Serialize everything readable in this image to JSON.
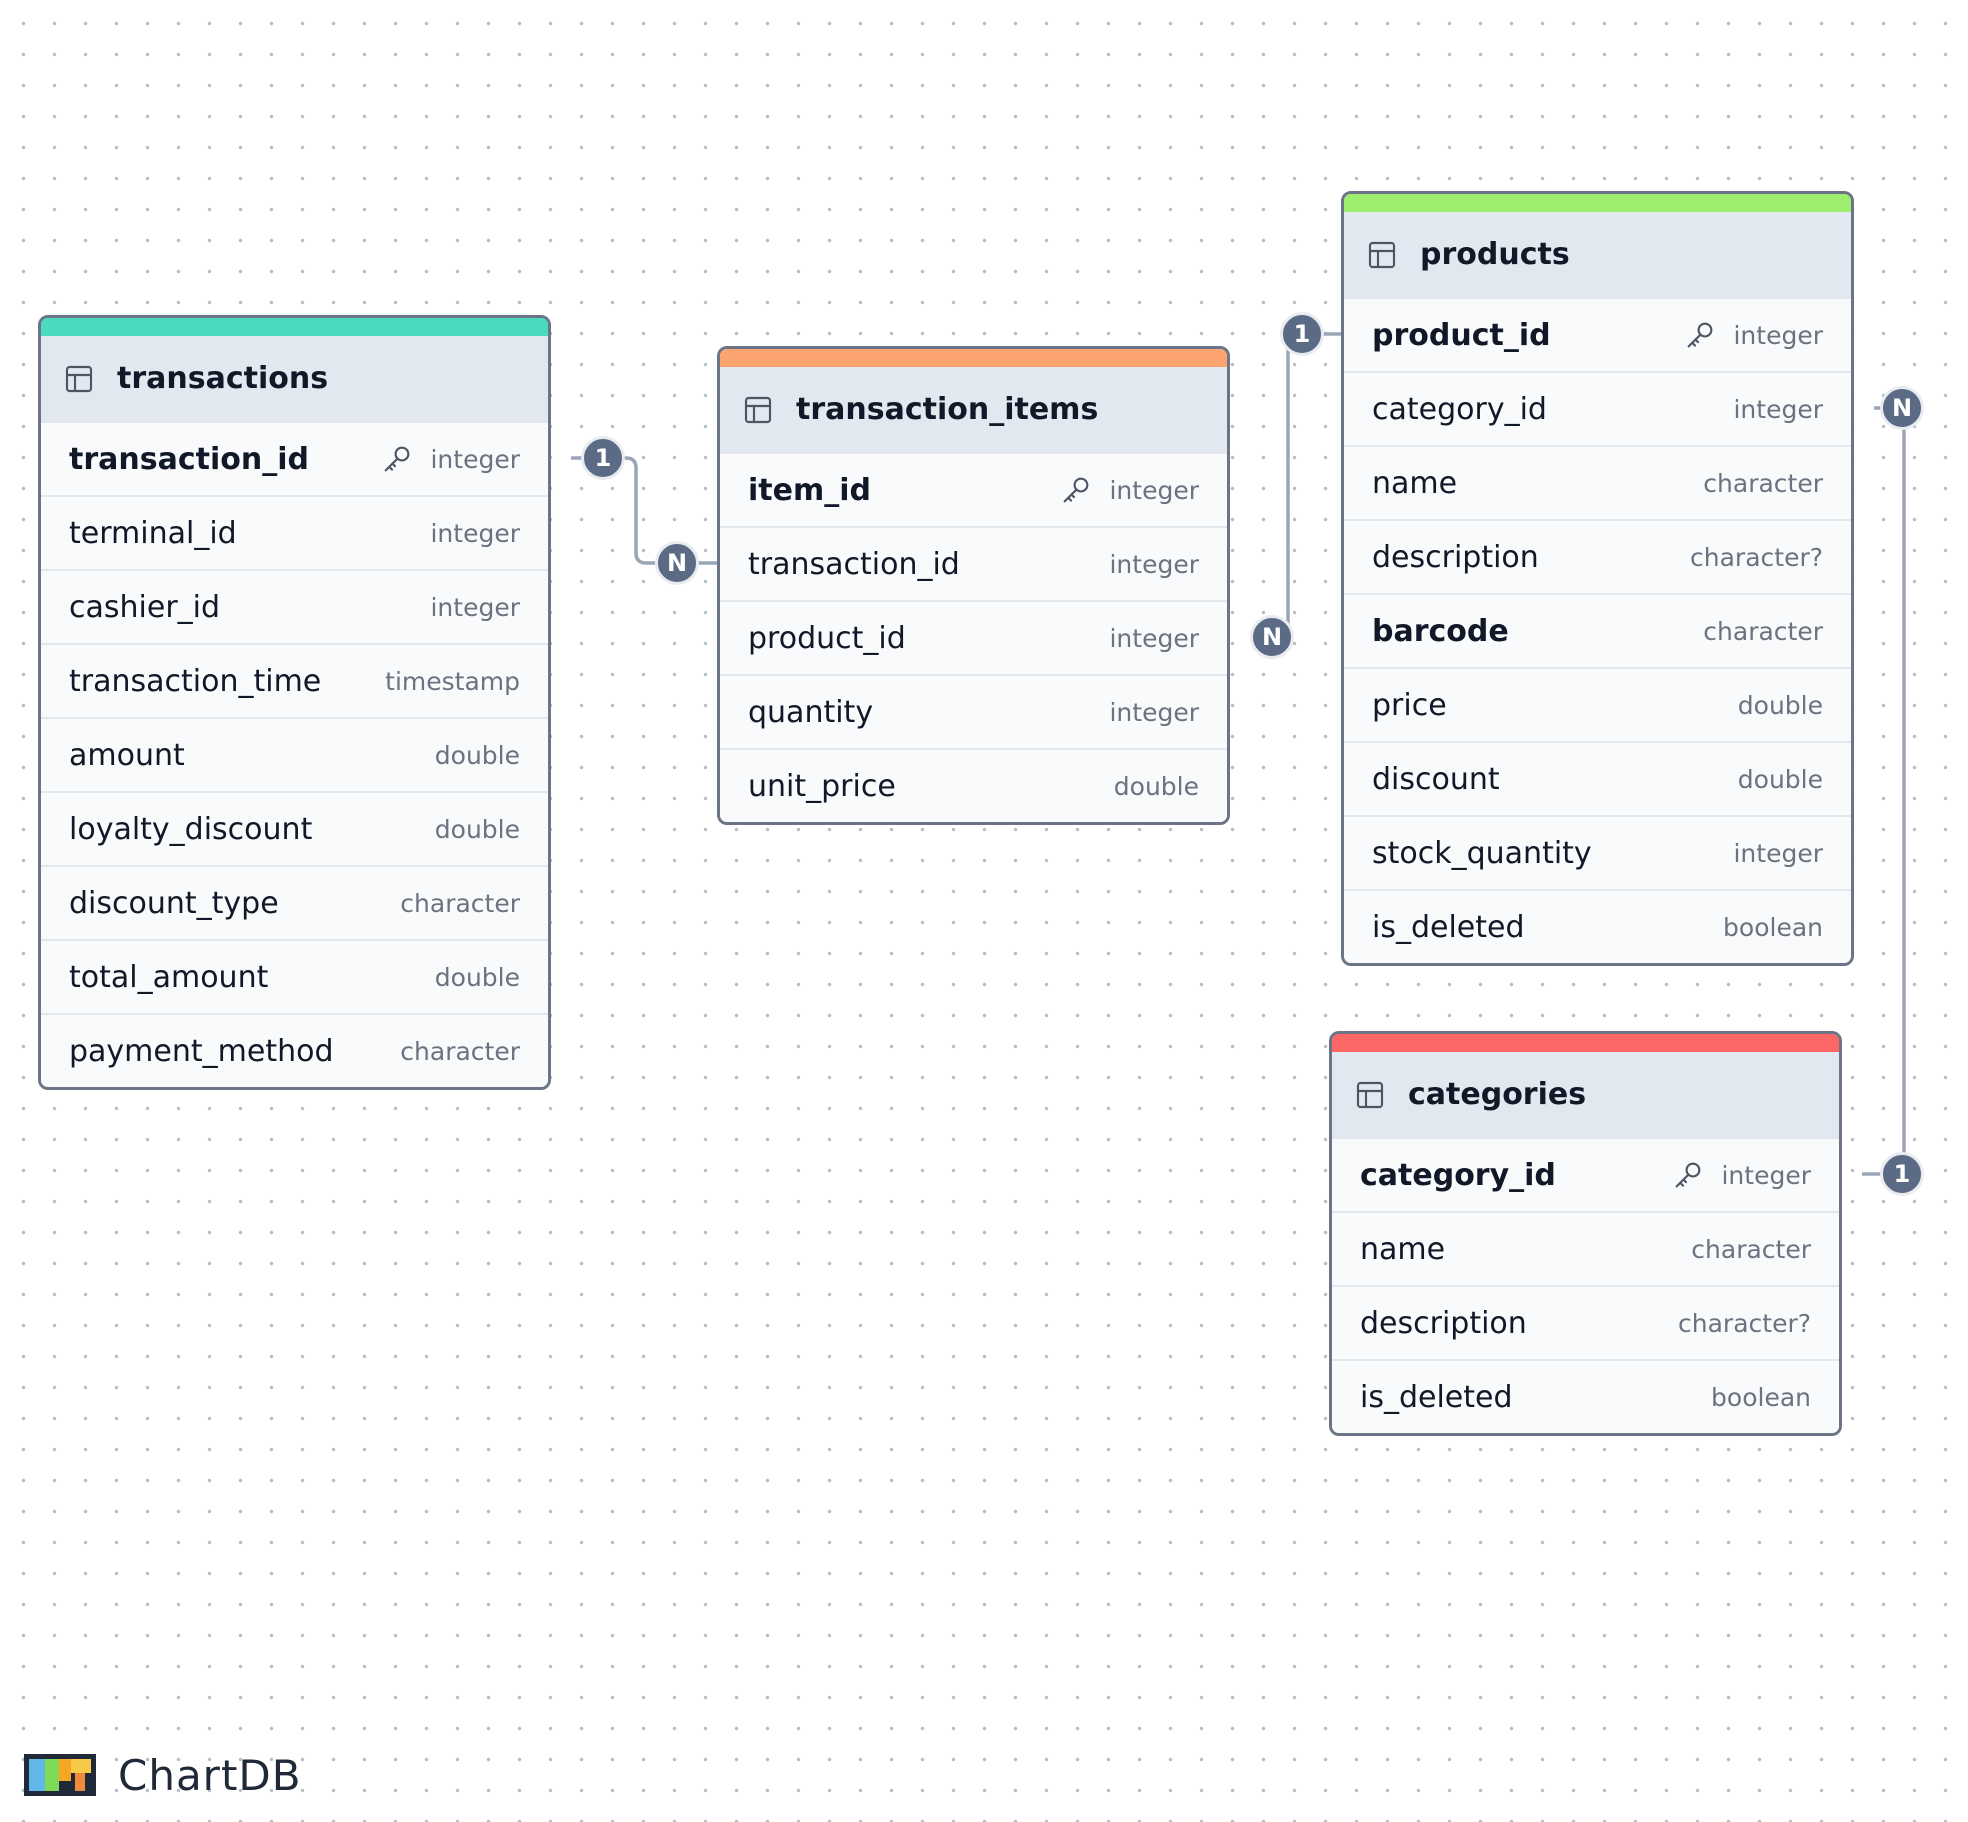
{
  "colors": {
    "transactions": "#48dbc0",
    "transaction_items": "#fca46f",
    "products": "#9ded6f",
    "categories": "#fd6666",
    "edge": "#9aa5b5",
    "badge": "#5b6b85"
  },
  "tables": [
    {
      "key": "transactions",
      "name": "transactions",
      "fields": [
        {
          "name": "transaction_id",
          "type": "integer",
          "pk": true,
          "bold": true
        },
        {
          "name": "terminal_id",
          "type": "integer"
        },
        {
          "name": "cashier_id",
          "type": "integer"
        },
        {
          "name": "transaction_time",
          "type": "timestamp"
        },
        {
          "name": "amount",
          "type": "double"
        },
        {
          "name": "loyalty_discount",
          "type": "double"
        },
        {
          "name": "discount_type",
          "type": "character"
        },
        {
          "name": "total_amount",
          "type": "double"
        },
        {
          "name": "payment_method",
          "type": "character"
        }
      ]
    },
    {
      "key": "transaction_items",
      "name": "transaction_items",
      "fields": [
        {
          "name": "item_id",
          "type": "integer",
          "pk": true,
          "bold": true
        },
        {
          "name": "transaction_id",
          "type": "integer"
        },
        {
          "name": "product_id",
          "type": "integer"
        },
        {
          "name": "quantity",
          "type": "integer"
        },
        {
          "name": "unit_price",
          "type": "double"
        }
      ]
    },
    {
      "key": "products",
      "name": "products",
      "fields": [
        {
          "name": "product_id",
          "type": "integer",
          "pk": true,
          "bold": true
        },
        {
          "name": "category_id",
          "type": "integer"
        },
        {
          "name": "name",
          "type": "character"
        },
        {
          "name": "description",
          "type": "character?"
        },
        {
          "name": "barcode",
          "type": "character",
          "bold": true
        },
        {
          "name": "price",
          "type": "double"
        },
        {
          "name": "discount",
          "type": "double"
        },
        {
          "name": "stock_quantity",
          "type": "integer"
        },
        {
          "name": "is_deleted",
          "type": "boolean"
        }
      ]
    },
    {
      "key": "categories",
      "name": "categories",
      "fields": [
        {
          "name": "category_id",
          "type": "integer",
          "pk": true,
          "bold": true
        },
        {
          "name": "name",
          "type": "character"
        },
        {
          "name": "description",
          "type": "character?"
        },
        {
          "name": "is_deleted",
          "type": "boolean"
        }
      ]
    }
  ],
  "relationships": [
    {
      "from_table": "transactions",
      "from_field": "transaction_id",
      "from_label": "1",
      "to_table": "transaction_items",
      "to_field": "transaction_id",
      "to_label": "N"
    },
    {
      "from_table": "products",
      "from_field": "product_id",
      "from_label": "1",
      "to_table": "transaction_items",
      "to_field": "product_id",
      "to_label": "N"
    },
    {
      "from_table": "categories",
      "from_field": "category_id",
      "from_label": "1",
      "to_table": "products",
      "to_field": "category_id",
      "to_label": "N"
    }
  ],
  "logo": {
    "text": "ChartDB"
  }
}
